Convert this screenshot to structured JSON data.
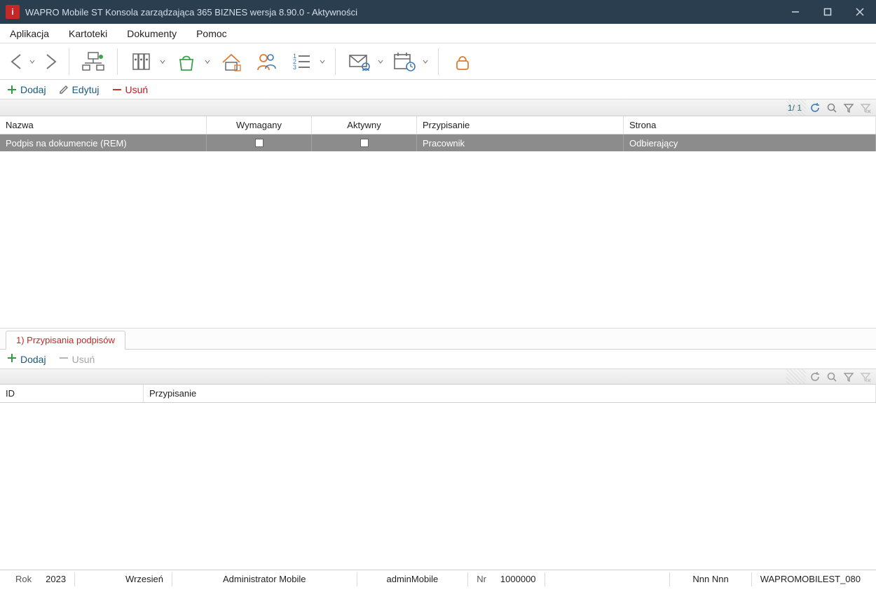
{
  "window": {
    "title": "WAPRO Mobile ST Konsola zarządzająca 365 BIZNES wersja 8.90.0 - Aktywności",
    "icon_letter": "i"
  },
  "menu": {
    "items": [
      "Aplikacja",
      "Kartoteki",
      "Dokumenty",
      "Pomoc"
    ]
  },
  "actions": {
    "add": "Dodaj",
    "edit": "Edytuj",
    "delete": "Usuń"
  },
  "grid_top": {
    "pagination": "1/ 1",
    "columns": {
      "nazwa": "Nazwa",
      "wymagany": "Wymagany",
      "aktywny": "Aktywny",
      "przypisanie": "Przypisanie",
      "strona": "Strona"
    },
    "rows": [
      {
        "nazwa": "Podpis na dokumencie (REM)",
        "wymagany": false,
        "aktywny": false,
        "przypisanie": "Pracownik",
        "strona": "Odbierający"
      }
    ]
  },
  "tab": {
    "label": "1) Przypisania podpisów"
  },
  "actions2": {
    "add": "Dodaj",
    "delete": "Usuń"
  },
  "grid_bot": {
    "columns": {
      "id": "ID",
      "przypisanie": "Przypisanie"
    }
  },
  "status": {
    "rok_label": "Rok",
    "rok_val": "2023",
    "miesiac_val": "Wrzesień",
    "role": "Administrator Mobile",
    "user": "adminMobile",
    "nr_label": "Nr",
    "nr_val": "1000000",
    "name": "Nnn Nnn",
    "code": "WAPROMOBILEST_080"
  }
}
